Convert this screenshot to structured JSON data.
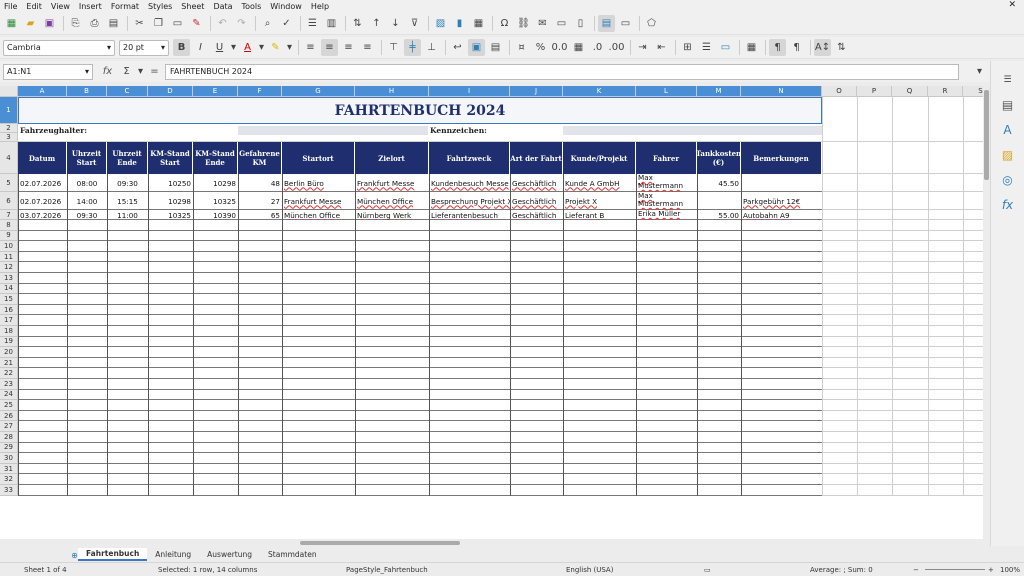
{
  "menu": [
    "File",
    "Edit",
    "View",
    "Insert",
    "Format",
    "Styles",
    "Sheet",
    "Data",
    "Tools",
    "Window",
    "Help"
  ],
  "toolbar": {
    "font_name": "Cambria",
    "font_size": "20 pt"
  },
  "formula_bar": {
    "cell_ref": "A1:N1",
    "content": "FAHRTENBUCH 2024",
    "fx": "fx",
    "sum": "Σ",
    "equals": "="
  },
  "columns": [
    "A",
    "B",
    "C",
    "D",
    "E",
    "F",
    "G",
    "H",
    "I",
    "J",
    "K",
    "L",
    "M",
    "N",
    "O",
    "P",
    "Q",
    "R",
    "S"
  ],
  "rows": [
    "1",
    "2",
    "3",
    "4",
    "5",
    "6",
    "7",
    "8",
    "9",
    "10",
    "11",
    "12",
    "13",
    "14",
    "15",
    "16",
    "17",
    "18",
    "19",
    "20",
    "21",
    "22",
    "23",
    "24",
    "25",
    "26",
    "27",
    "28",
    "29",
    "30",
    "31",
    "32",
    "33"
  ],
  "sheet": {
    "title": "FAHRTENBUCH 2024",
    "holder_label": "Fahrzeughalter:",
    "plate_label": "Kennzeichen:",
    "headers": [
      "Datum",
      "Uhrzeit Start",
      "Uhrzeit Ende",
      "KM-Stand Start",
      "KM-Stand Ende",
      "Gefahrene KM",
      "Startort",
      "Zielort",
      "Fahrtzweck",
      "Art der Fahrt",
      "Kunde/Projekt",
      "Fahrer",
      "Tankkosten (€)",
      "Bemerkungen"
    ],
    "data": [
      [
        "02.07.2026",
        "08:00",
        "09:30",
        "10250",
        "10298",
        "48",
        "Berlin Büro",
        "Frankfurt Messe",
        "Kundenbesuch Messe",
        "Geschäftlich",
        "Kunde A GmbH",
        "Max Mustermann",
        "45.50",
        ""
      ],
      [
        "02.07.2026",
        "14:00",
        "15:15",
        "10298",
        "10325",
        "27",
        "Frankfurt Messe",
        "München Office",
        "Besprechung Projekt X",
        "Geschäftlich",
        "Projekt X",
        "Max Mustermann",
        "",
        "Parkgebühr 12€"
      ],
      [
        "03.07.2026",
        "09:30",
        "11:00",
        "10325",
        "10390",
        "65",
        "München Office",
        "Nürnberg Werk",
        "Lieferantenbesuch",
        "Geschäftlich",
        "Lieferant B",
        "Erika Müller",
        "55.00",
        "Autobahn A9"
      ]
    ]
  },
  "tabs": [
    "Fahrtenbuch",
    "Anleitung",
    "Auswertung",
    "Stammdaten"
  ],
  "status": {
    "sheet": "Sheet 1 of 4",
    "selection": "Selected: 1 row, 14 columns",
    "page_style": "PageStyle_Fahrtenbuch",
    "language": "English (USA)",
    "summary": "Average: ; Sum: 0",
    "zoom": "100%"
  },
  "colors": {
    "header_bg": "#1f2e6e",
    "title_color": "#1f2f6b",
    "selection": "#4a8ed6"
  }
}
